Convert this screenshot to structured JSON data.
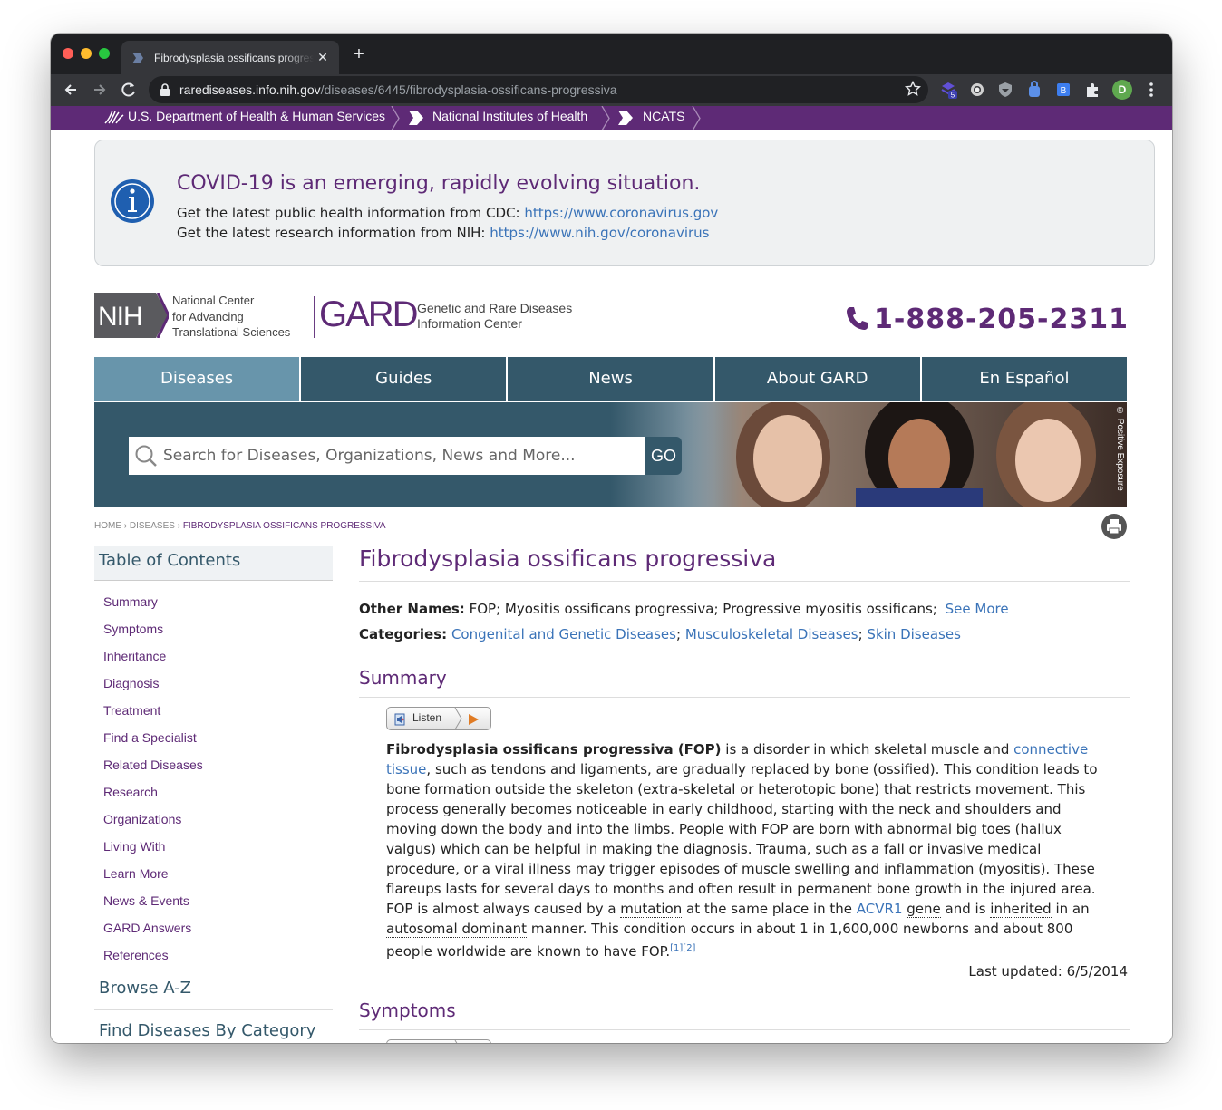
{
  "browser": {
    "tab_title": "Fibrodysplasia ossificans progressiva",
    "close_glyph": "✕",
    "new_tab_glyph": "+",
    "url_host": "rarediseases.info.nih.gov",
    "url_path": "/diseases/6445/fibrodysplasia-ossificans-progressiva",
    "ext_badge": "5",
    "profile_initial": "D"
  },
  "agency_bar": {
    "hhs": "U.S. Department of Health & Human Services",
    "nih": "National Institutes of Health",
    "ncats": "NCATS"
  },
  "covid": {
    "title": "COVID-19 is an emerging, rapidly evolving situation.",
    "cdc_text": "Get the latest public health information from CDC:",
    "cdc_link": "https://www.coronavirus.gov",
    "nih_text": "Get the latest research information from NIH:",
    "nih_link": "https://www.nih.gov/coronavirus"
  },
  "header": {
    "nih_logo": "NIH",
    "ncats_line1": "National Center",
    "ncats_line2": "for Advancing",
    "ncats_line3": "Translational Sciences",
    "gard": "GARD",
    "gard_line1": "Genetic and Rare Diseases",
    "gard_line2": "Information Center",
    "phone": "1-888-205-2311"
  },
  "nav": {
    "items": [
      "Diseases",
      "Guides",
      "News",
      "About GARD",
      "En Español"
    ],
    "active": "Diseases"
  },
  "search": {
    "placeholder": "Search for Diseases, Organizations, News and More...",
    "go": "GO",
    "photo_credit": "© Positive Exposure"
  },
  "breadcrumb": {
    "home": "HOME",
    "diseases": "DISEASES",
    "current": "FIBRODYSPLASIA OSSIFICANS PROGRESSIVA"
  },
  "toc": {
    "title": "Table of Contents",
    "items": [
      "Summary",
      "Symptoms",
      "Inheritance",
      "Diagnosis",
      "Treatment",
      "Find a Specialist",
      "Related Diseases",
      "Research",
      "Organizations",
      "Living With",
      "Learn More",
      "News & Events",
      "GARD Answers",
      "References"
    ],
    "browse": "Browse A-Z",
    "category": "Find Diseases By Category"
  },
  "disease": {
    "title": "Fibrodysplasia ossificans progressiva",
    "other_names_label": "Other Names:",
    "other_names": "FOP; Myositis ossificans progressiva; Progressive myositis ossificans;",
    "see_more": "See More",
    "categories_label": "Categories:",
    "categories": [
      "Congenital and Genetic Diseases",
      "Musculoskeletal Diseases",
      "Skin Diseases"
    ],
    "summary_head": "Summary",
    "symptoms_head": "Symptoms",
    "listen": "Listen",
    "summary": {
      "bold": "Fibrodysplasia ossificans progressiva (FOP)",
      "t1": " is a disorder in which skeletal muscle and ",
      "link1": "connective tissue",
      "t2": ", such as tendons and ligaments, are gradually replaced by bone (ossified). This condition leads to bone formation outside the skeleton (extra-skeletal or heterotopic bone) that restricts movement. This process generally becomes noticeable in early childhood, starting with the neck and shoulders and moving down the body and into the limbs. People with FOP are born with abnormal big toes (hallux valgus) which can be helpful in making the diagnosis. Trauma, such as a fall or invasive medical procedure, or a viral illness may trigger episodes of muscle swelling and inflammation (myositis). These flareups lasts for several days to months and often result in permanent bone growth in the injured area. FOP is almost always caused by a ",
      "term1": "mutation",
      "t3": " at the same place in the ",
      "link2": "ACVR1",
      "t4": " ",
      "term2": "gene",
      "t5": " and is ",
      "term3": "inherited",
      "t6": " in an ",
      "term4": "autosomal dominant",
      "t7": " manner. This condition occurs in about 1 in 1,600,000 newborns and about 800 people worldwide are known to have FOP.",
      "refs": "[1][2]"
    },
    "last_updated": "Last updated: 6/5/2014"
  }
}
